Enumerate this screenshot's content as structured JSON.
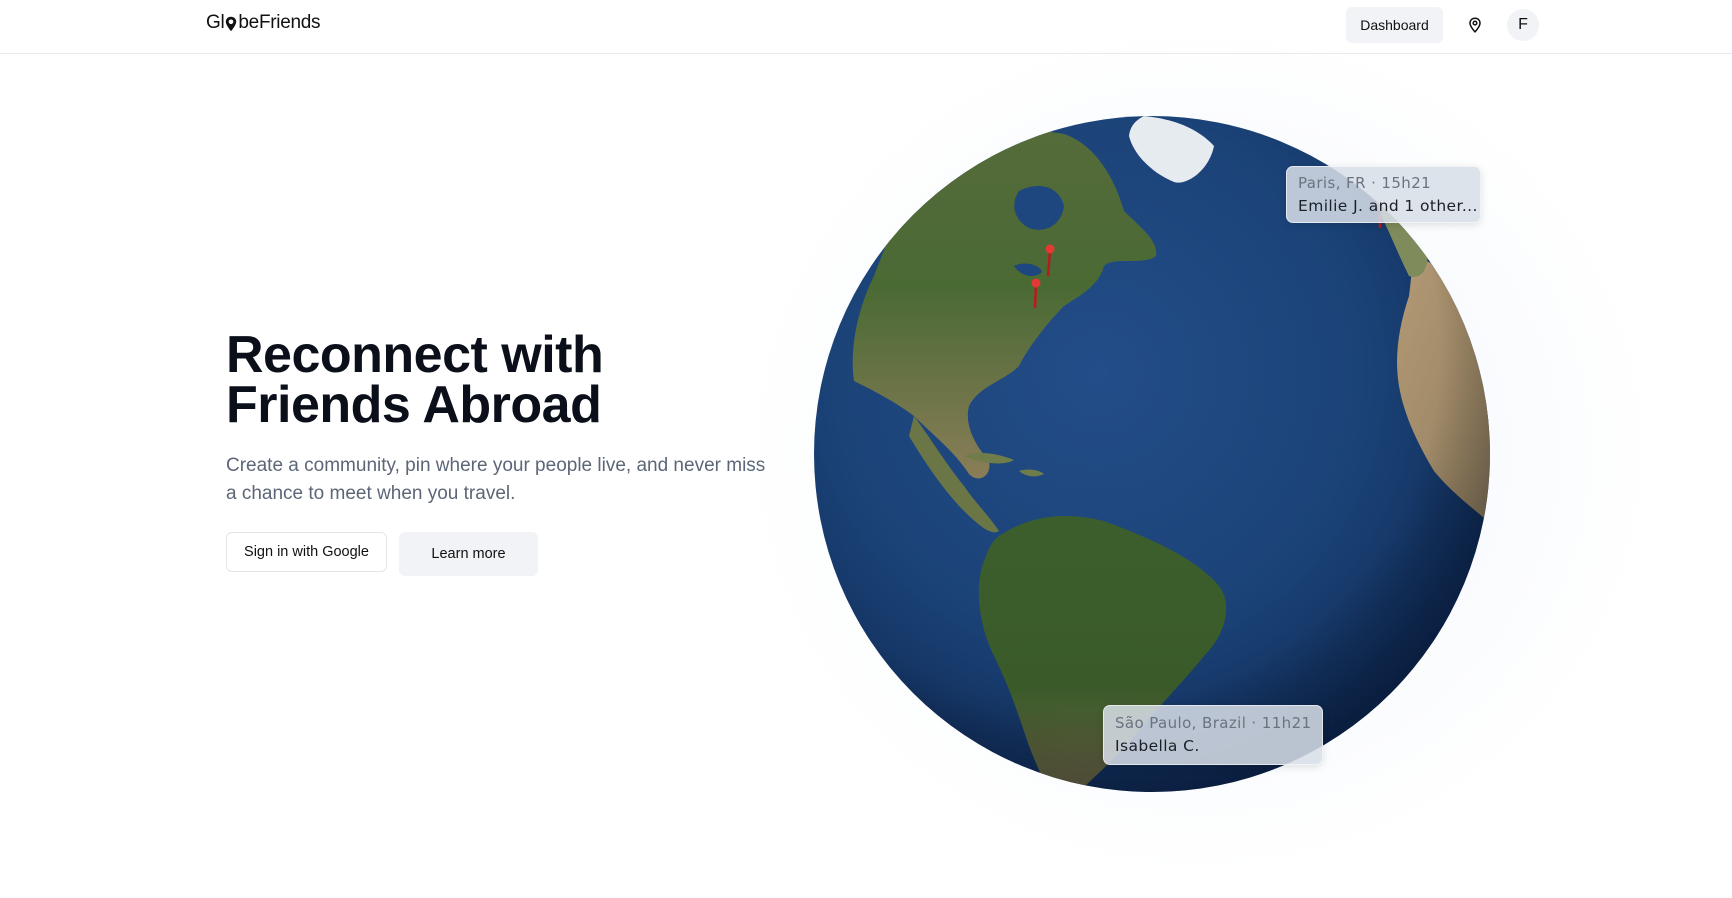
{
  "header": {
    "logo": {
      "prefix": "Gl",
      "suffix": "beFriends"
    },
    "dashboard_label": "Dashboard",
    "location_icon": "map-pin-icon",
    "avatar_initial": "F"
  },
  "hero": {
    "title": "Reconnect with Friends Abroad",
    "subtitle": "Create a community, pin where your people live, and never miss a chance to meet when you travel.",
    "signin_label": "Sign in with Google",
    "learn_more_label": "Learn more"
  },
  "globe": {
    "pins": [
      {
        "name": "pin-north-east-us"
      },
      {
        "name": "pin-east-coast-us"
      },
      {
        "name": "pin-paris"
      }
    ],
    "tooltips": [
      {
        "location": "Paris, FR · 15h21",
        "people": "Emilie J. and 1 other..."
      },
      {
        "location": "São Paulo, Brazil · 11h21",
        "people": "Isabella C."
      }
    ]
  },
  "colors": {
    "accent": "#0b0f19",
    "ocean": "#1d4379",
    "pin": "#d32f2f",
    "muted_text": "#5c6678"
  }
}
